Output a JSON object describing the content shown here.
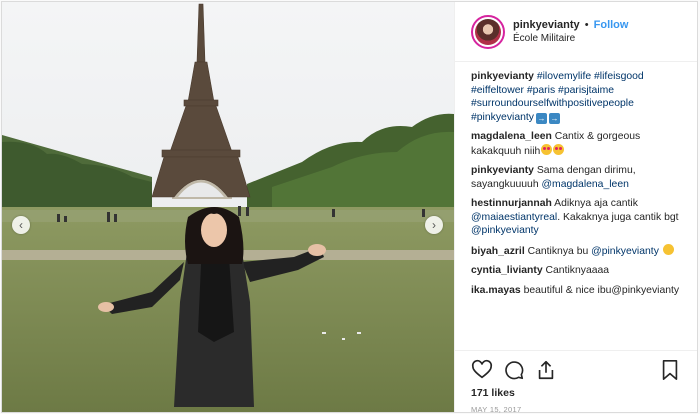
{
  "post": {
    "username": "pinkyevianty",
    "follow_label": "Follow",
    "separator": "•",
    "location": "École Militaire",
    "caption": {
      "username": "pinkyevianty",
      "tags": [
        "#ilovemylife",
        "#lifeisgood",
        "#eiffeltower",
        "#paris",
        "#parisjtaime",
        "#surroundourselfwithpositivepeople",
        "#pinkyevianty"
      ]
    },
    "comments": [
      {
        "user": "magdalena_leen",
        "text": "Cantix & gorgeous kakakquuh niih",
        "emoji": [
          "heart-eyes",
          "heart-eyes"
        ]
      },
      {
        "user": "pinkyevianty",
        "text": "Sama dengan dirimu, sayangkuuuuh",
        "mention": "@magdalena_leen"
      },
      {
        "user": "hestinnurjannah",
        "text": "Adiknya aja cantik",
        "mention": "@maiaestiantyreal",
        "text2": ". Kakaknya juga cantik bgt",
        "mention2": "@pinkyevianty"
      },
      {
        "user": "biyah_azril",
        "text": "Cantiknya bu",
        "mention": "@pinkyevianty",
        "emoji": [
          "smile"
        ]
      },
      {
        "user": "cyntia_livianty",
        "text": "Cantiknyaaaa"
      },
      {
        "user": "ika.mayas",
        "text": "beautiful & nice ibu@pinkyevianty"
      }
    ],
    "likes": "171 likes",
    "date": "MAY 15, 2017",
    "icons": [
      "heart-icon",
      "comment-icon",
      "share-icon",
      "bookmark-icon",
      "chevron-left-icon",
      "chevron-right-icon"
    ]
  }
}
